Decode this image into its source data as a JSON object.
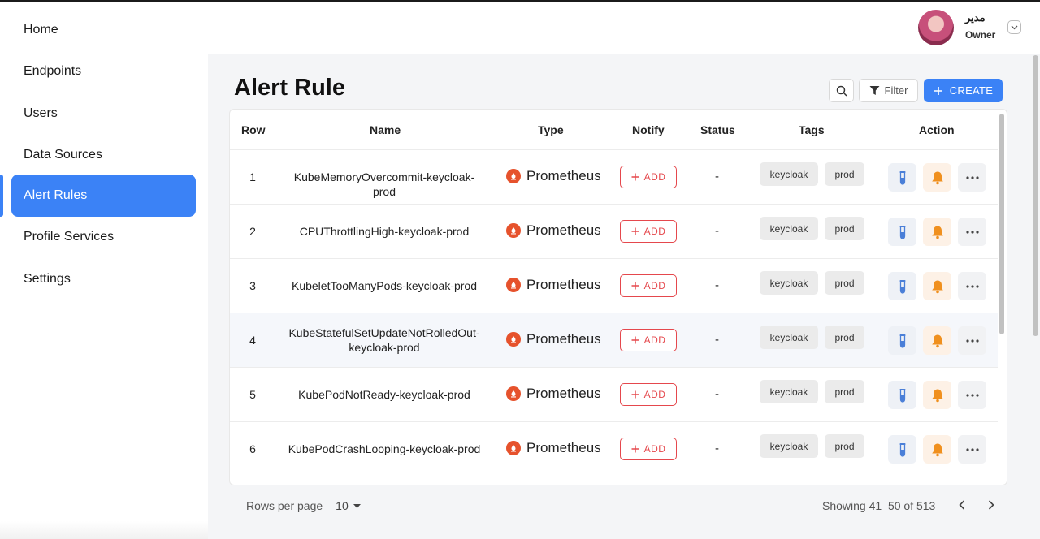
{
  "sidebar": {
    "items": [
      {
        "label": "Home",
        "active": false
      },
      {
        "label": "Endpoints",
        "active": false
      },
      {
        "label": "Users",
        "active": false
      },
      {
        "label": "Data Sources",
        "active": false
      },
      {
        "label": "Alert Rules",
        "active": true
      },
      {
        "label": "Profile Services",
        "active": false
      },
      {
        "label": "Settings",
        "active": false
      }
    ]
  },
  "user": {
    "name": "مدير",
    "role": "Owner",
    "avatar_icon": "avatar-photo"
  },
  "page": {
    "title": "Alert Rule",
    "filter_label": "Filter",
    "create_label": "CREATE"
  },
  "table": {
    "columns": [
      "Row",
      "Name",
      "Type",
      "Notify",
      "Status",
      "Tags",
      "Action"
    ],
    "add_label": "ADD",
    "rows": [
      {
        "row": "1",
        "name": "KubeMemoryOvercommit-keycloak-prod",
        "type": "Prometheus",
        "status": "-",
        "tags": [
          "keycloak",
          "prod"
        ]
      },
      {
        "row": "2",
        "name": "CPUThrottlingHigh-keycloak-prod",
        "type": "Prometheus",
        "status": "-",
        "tags": [
          "keycloak",
          "prod"
        ]
      },
      {
        "row": "3",
        "name": "KubeletTooManyPods-keycloak-prod",
        "type": "Prometheus",
        "status": "-",
        "tags": [
          "keycloak",
          "prod"
        ]
      },
      {
        "row": "4",
        "name": "KubeStatefulSetUpdateNotRolledOut-keycloak-prod",
        "type": "Prometheus",
        "status": "-",
        "tags": [
          "keycloak",
          "prod"
        ]
      },
      {
        "row": "5",
        "name": "KubePodNotReady-keycloak-prod",
        "type": "Prometheus",
        "status": "-",
        "tags": [
          "keycloak",
          "prod"
        ]
      },
      {
        "row": "6",
        "name": "KubePodCrashLooping-keycloak-prod",
        "type": "Prometheus",
        "status": "-",
        "tags": [
          "keycloak",
          "prod"
        ]
      }
    ]
  },
  "footer": {
    "rows_per_page_label": "Rows per page",
    "rows_per_page_value": "10",
    "showing": "Showing 41–50 of 513"
  },
  "colors": {
    "accent": "#3b82f6",
    "danger": "#e5484d",
    "prometheus": "#e6522c",
    "bell": "#f0901e",
    "test": "#4a7fd8"
  }
}
